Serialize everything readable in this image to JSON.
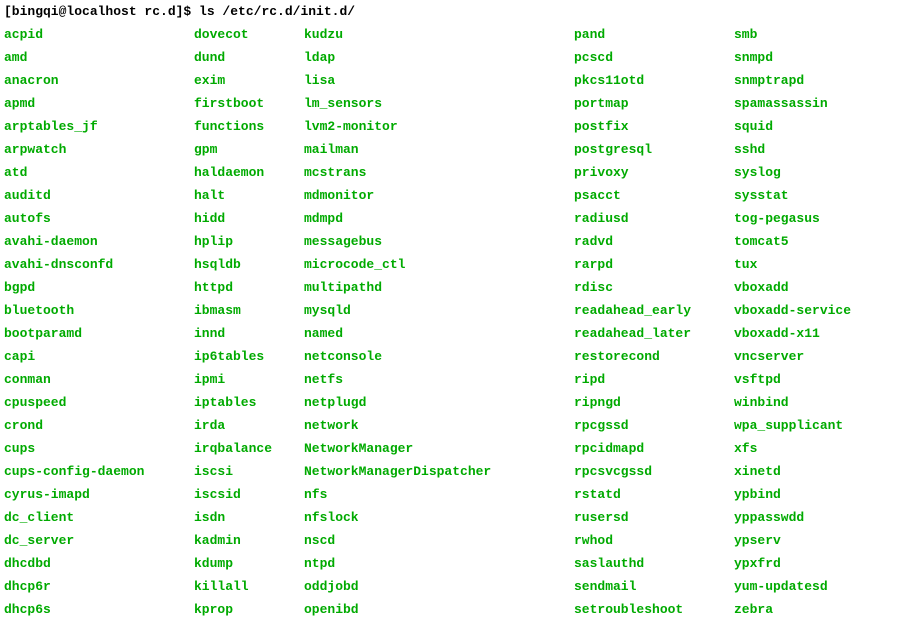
{
  "prompt": "[bingqi@localhost rc.d]$ ls /etc/rc.d/init.d/",
  "columns": {
    "col1": [
      "acpid",
      "amd",
      "anacron",
      "apmd",
      "arptables_jf",
      "arpwatch",
      "atd",
      "auditd",
      "autofs",
      "avahi-daemon",
      "avahi-dnsconfd",
      "bgpd",
      "bluetooth",
      "bootparamd",
      "capi",
      "conman",
      "cpuspeed",
      "crond",
      "cups",
      "cups-config-daemon",
      "cyrus-imapd",
      "dc_client",
      "dc_server",
      "dhcdbd",
      "dhcp6r",
      "dhcp6s"
    ],
    "col2": [
      "dovecot",
      "dund",
      "exim",
      "firstboot",
      "functions",
      "gpm",
      "haldaemon",
      "halt",
      "hidd",
      "hplip",
      "hsqldb",
      "httpd",
      "ibmasm",
      "innd",
      "ip6tables",
      "ipmi",
      "iptables",
      "irda",
      "irqbalance",
      "iscsi",
      "iscsid",
      "isdn",
      "kadmin",
      "kdump",
      "killall",
      "kprop"
    ],
    "col3": [
      "kudzu",
      "ldap",
      "lisa",
      "lm_sensors",
      "lvm2-monitor",
      "mailman",
      "mcstrans",
      "mdmonitor",
      "mdmpd",
      "messagebus",
      "microcode_ctl",
      "multipathd",
      "mysqld",
      "named",
      "netconsole",
      "netfs",
      "netplugd",
      "network",
      "NetworkManager",
      "NetworkManagerDispatcher",
      "nfs",
      "nfslock",
      "nscd",
      "ntpd",
      "oddjobd",
      "openibd"
    ],
    "col4": [
      "pand",
      "pcscd",
      "pkcs11otd",
      "portmap",
      "postfix",
      "postgresql",
      "privoxy",
      "psacct",
      "radiusd",
      "radvd",
      "rarpd",
      "rdisc",
      "readahead_early",
      "readahead_later",
      "restorecond",
      "ripd",
      "ripngd",
      "rpcgssd",
      "rpcidmapd",
      "rpcsvcgssd",
      "rstatd",
      "rusersd",
      "rwhod",
      "saslauthd",
      "sendmail",
      "setroubleshoot"
    ],
    "col5": [
      "smb",
      "snmpd",
      "snmptrapd",
      "spamassassin",
      "squid",
      "sshd",
      "syslog",
      "sysstat",
      "tog-pegasus",
      "tomcat5",
      "tux",
      "vboxadd",
      "vboxadd-service",
      "vboxadd-x11",
      "vncserver",
      "vsftpd",
      "winbind",
      "wpa_supplicant",
      "xfs",
      "xinetd",
      "ypbind",
      "yppasswdd",
      "ypserv",
      "ypxfrd",
      "yum-updatesd",
      "zebra"
    ]
  }
}
